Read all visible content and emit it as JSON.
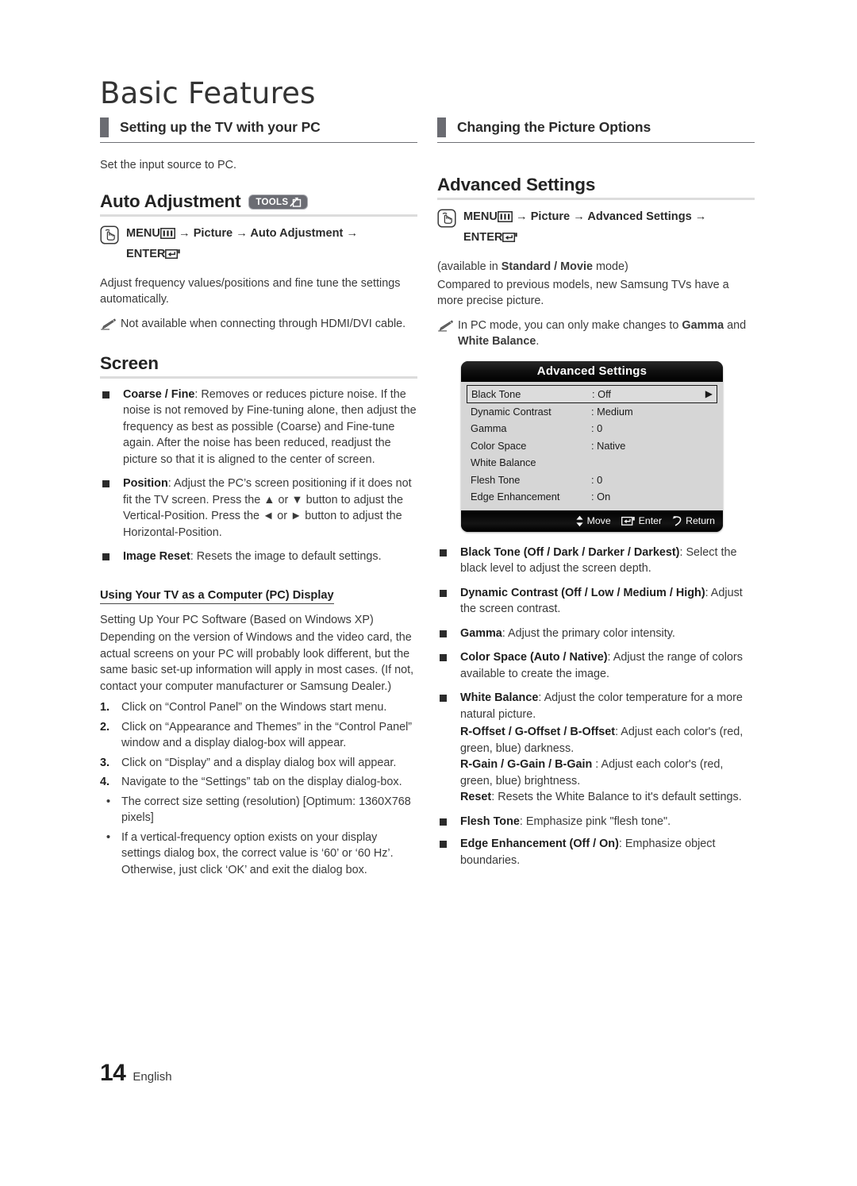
{
  "header": {
    "title": "Basic Features"
  },
  "footer": {
    "page_number": "14",
    "language": "English"
  },
  "left_column": {
    "section_title": "Setting up the TV with your PC",
    "intro": "Set the input source to PC.",
    "auto_adjustment": {
      "heading": "Auto Adjustment",
      "tools_badge": "TOOLS",
      "nav_path": "MENU → Picture → Auto Adjustment → ENTER",
      "nav_parts": {
        "menu": "MENU",
        "arrow": "→",
        "picture": "Picture",
        "target": "Auto Adjustment",
        "enter": "ENTER"
      },
      "description": "Adjust frequency values/positions and fine tune the settings automatically.",
      "note": "Not available when connecting through HDMI/DVI cable."
    },
    "screen": {
      "heading": "Screen",
      "bullets": [
        {
          "term": "Coarse / Fine",
          "text": ": Removes or reduces picture noise. If the noise is not removed by Fine-tuning alone, then adjust the frequency as best as possible (Coarse) and Fine-tune again. After the noise has been reduced, readjust the picture so that it is aligned to the center of screen."
        },
        {
          "term": "Position",
          "text": ": Adjust the PC’s screen positioning if it does not fit the TV screen. Press the ▲ or ▼ button to adjust the Vertical-Position. Press the ◄ or ► button to adjust the Horizontal-Position."
        },
        {
          "term": "Image Reset",
          "text": ": Resets the image to default settings."
        }
      ]
    },
    "pc_display": {
      "sub_heading": "Using Your TV as a Computer (PC) Display",
      "paragraphs": [
        "Setting Up Your PC Software (Based on Windows XP)",
        "Depending on the version of Windows and the video card, the actual screens on your PC will probably look different, but the same basic set-up information will apply in most cases. (If not, contact your computer manufacturer or Samsung Dealer.)"
      ],
      "steps": [
        {
          "num": "1.",
          "text": "Click on “Control Panel” on the Windows start menu."
        },
        {
          "num": "2.",
          "text": "Click on “Appearance and Themes” in the “Control Panel” window and a display dialog-box will appear."
        },
        {
          "num": "3.",
          "text": "Click on “Display” and a display dialog box will appear."
        },
        {
          "num": "4.",
          "text": "Navigate to the “Settings” tab on the display dialog-box."
        }
      ],
      "dot_items": [
        "The correct size setting (resolution) [Optimum: 1360X768 pixels]",
        "If a vertical-frequency option exists on your display settings dialog box, the correct value is ‘60’ or ‘60 Hz’. Otherwise, just click ‘OK’ and exit the dialog box."
      ]
    }
  },
  "right_column": {
    "section_title": "Changing the Picture Options",
    "advanced_settings": {
      "heading": "Advanced Settings",
      "nav_parts": {
        "menu": "MENU",
        "arrow": "→",
        "picture": "Picture",
        "target": "Advanced Settings",
        "enter": "ENTER"
      },
      "availability_prefix": "(available in ",
      "availability_bold": "Standard / Movie",
      "availability_suffix": " mode)",
      "description": "Compared to previous models, new Samsung TVs have a more precise picture.",
      "note_prefix": "In PC mode, you can only make changes to ",
      "note_bold1": "Gamma",
      "note_mid": " and ",
      "note_bold2": "White Balance",
      "note_suffix": "."
    },
    "osd": {
      "title": "Advanced Settings",
      "rows": [
        {
          "label": "Black Tone",
          "value": ": Off",
          "selected": true,
          "arrow": "▶"
        },
        {
          "label": "Dynamic Contrast",
          "value": ": Medium",
          "selected": false,
          "arrow": ""
        },
        {
          "label": "Gamma",
          "value": ": 0",
          "selected": false,
          "arrow": ""
        },
        {
          "label": "Color Space",
          "value": ": Native",
          "selected": false,
          "arrow": ""
        },
        {
          "label": "White Balance",
          "value": "",
          "selected": false,
          "arrow": ""
        },
        {
          "label": "Flesh Tone",
          "value": ": 0",
          "selected": false,
          "arrow": ""
        },
        {
          "label": "Edge Enhancement",
          "value": ": On",
          "selected": false,
          "arrow": ""
        }
      ],
      "footer": {
        "move": "Move",
        "enter": "Enter",
        "return": "Return"
      }
    },
    "bullets": [
      {
        "term": "Black Tone (Off / Dark / Darker / Darkest)",
        "text": ": Select the black level to adjust the screen depth."
      },
      {
        "term": "Dynamic Contrast (Off / Low / Medium / High)",
        "text": ": Adjust the screen contrast."
      },
      {
        "term": "Gamma",
        "text": ": Adjust the primary color intensity."
      },
      {
        "term": "Color Space (Auto / Native)",
        "text": ": Adjust the range of colors available to create the image."
      },
      {
        "term": "White Balance",
        "text": ": Adjust the color temperature for a more natural picture."
      }
    ],
    "white_balance_subitems": [
      {
        "term": "R-Offset / G-Offset / B-Offset",
        "text": ": Adjust each color's (red, green, blue) darkness."
      },
      {
        "term": "R-Gain / G-Gain / B-Gain",
        "text": " : Adjust each color's (red, green, blue) brightness."
      },
      {
        "term": "Reset",
        "text": ": Resets the White Balance to it's default settings."
      }
    ],
    "bullets_tail": [
      {
        "term": "Flesh Tone",
        "text": ": Emphasize pink \"flesh tone\"."
      },
      {
        "term": "Edge Enhancement (Off / On)",
        "text": ": Emphasize object boundaries."
      }
    ]
  },
  "colors": {
    "accent_bar": "#6b6c72",
    "rule": "#dcdcdc",
    "text": "#3a3a3a",
    "osd_panel": "#d6d6d6",
    "osd_chrome": "#0a0a0a"
  }
}
